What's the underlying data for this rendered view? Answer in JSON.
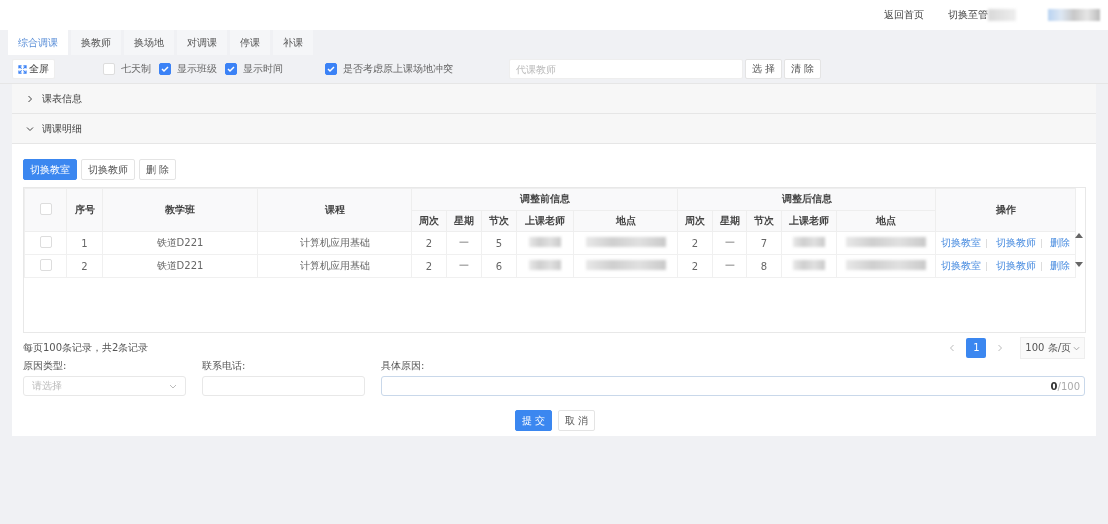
{
  "header_links": [
    {
      "label": "返回首页",
      "blurred_tail": false
    },
    {
      "label": "切换至管",
      "blurred_tail": true
    }
  ],
  "tabs": [
    {
      "label": "综合调课",
      "selected": true
    },
    {
      "label": "换教师",
      "selected": false
    },
    {
      "label": "换场地",
      "selected": false
    },
    {
      "label": "对调课",
      "selected": false
    },
    {
      "label": "停课",
      "selected": false
    },
    {
      "label": "补课",
      "selected": false
    }
  ],
  "toolbar": {
    "fullscreen_button": "全屏",
    "options": [
      {
        "label": "七天制",
        "checked": false
      },
      {
        "label": "显示班级",
        "checked": true
      },
      {
        "label": "显示时间",
        "checked": true
      }
    ],
    "conflict_option": {
      "label": "是否考虑原上课场地冲突",
      "checked": true
    },
    "teacher_field": {
      "placeholder": "代课教师"
    },
    "buttons": [
      "选 择",
      "清 除"
    ]
  },
  "panels": [
    {
      "title": "课表信息",
      "expanded": false
    },
    {
      "title": "调课明细",
      "expanded": true
    }
  ],
  "detail": {
    "buttons": [
      {
        "label": "切换教室",
        "primary": true
      },
      {
        "label": "切换教师",
        "primary": false
      },
      {
        "label": "删 除",
        "primary": false
      }
    ],
    "table": {
      "header_checked": false,
      "columns": {
        "seq": "序号",
        "class": "教学班",
        "course": "课程",
        "before": "调整前信息",
        "after": "调整后信息",
        "actions": "操作",
        "before_sub": [
          "周次",
          "星期",
          "节次",
          "上课老师",
          "地点"
        ],
        "after_sub": [
          "周次",
          "星期",
          "节次",
          "上课老师",
          "地点"
        ]
      },
      "rows": [
        {
          "checked": false,
          "seq": "1",
          "class": "铁道D221",
          "course": "计算机应用基础",
          "before": [
            "2",
            "一",
            "5"
          ],
          "after": [
            "2",
            "一",
            "7"
          ],
          "actions": [
            "切换教室",
            "切换教师",
            "删除"
          ]
        },
        {
          "checked": false,
          "seq": "2",
          "class": "铁道D221",
          "course": "计算机应用基础",
          "before": [
            "2",
            "一",
            "6"
          ],
          "after": [
            "2",
            "一",
            "8"
          ],
          "actions": [
            "切换教室",
            "切换教师",
            "删除"
          ]
        }
      ]
    }
  },
  "pagination": {
    "summary": "每页100条记录，共2条记录",
    "pages": [
      {
        "label": "1",
        "selected": true
      }
    ],
    "page_size": "100 条/页"
  },
  "form": {
    "reason_type": {
      "label": "原因类型:",
      "placeholder": "请选择"
    },
    "phone": {
      "label": "联系电话:"
    },
    "reason": {
      "label": "具体原因:",
      "counter": "**0**/100"
    }
  },
  "actions": [
    {
      "label": "提 交",
      "primary": true
    },
    {
      "label": "取 消",
      "primary": false
    }
  ]
}
